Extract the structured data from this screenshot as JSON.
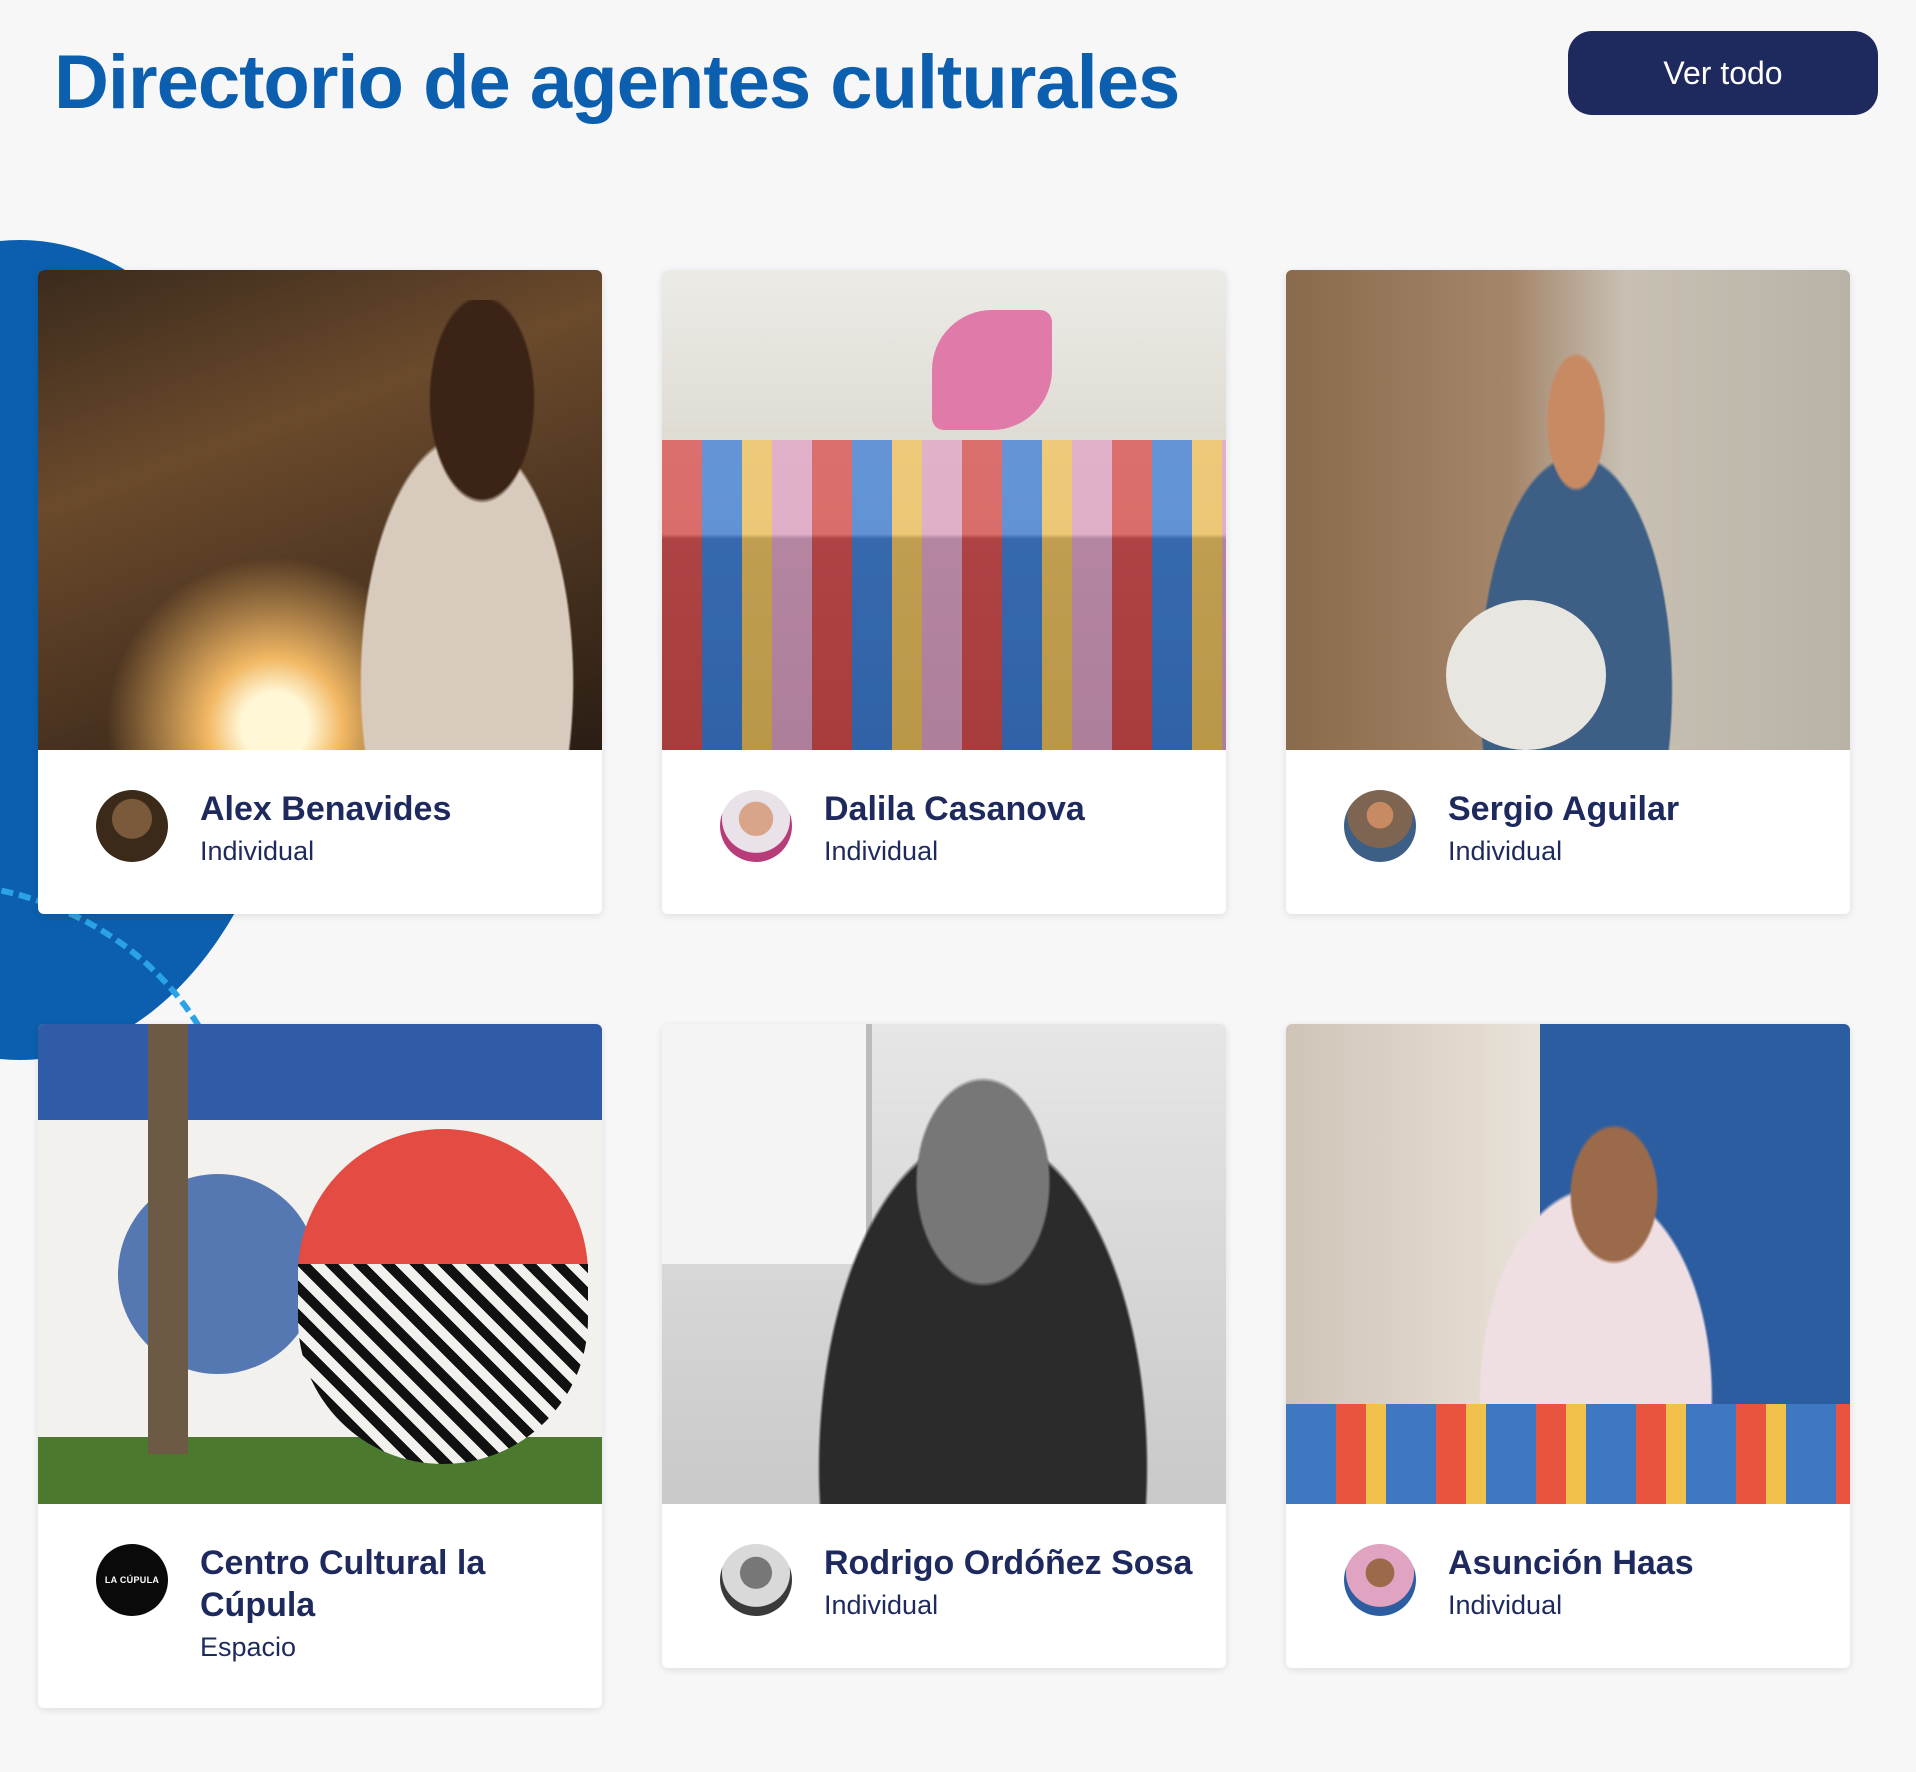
{
  "header": {
    "title": "Directorio de agentes culturales",
    "view_all_label": "Ver todo"
  },
  "colors": {
    "title": "#0b5fae",
    "button_bg": "#1e2a5e",
    "card_text": "#1e2a5e",
    "background": "#f7f7f8"
  },
  "cards": [
    {
      "name": "Alex Benavides",
      "type": "Individual",
      "photo": "stage-audience-photo",
      "avatar": "avatar-photo"
    },
    {
      "name": "Dalila Casanova",
      "type": "Individual",
      "photo": "children-group-photo",
      "avatar": "avatar-photo"
    },
    {
      "name": "Sergio Aguilar",
      "type": "Individual",
      "photo": "guitarist-photo",
      "avatar": "avatar-photo"
    },
    {
      "name": "Centro Cultural la Cúpula",
      "type": "Espacio",
      "photo": "mural-photo",
      "avatar": "logo",
      "avatar_text": "LA CÚPULA"
    },
    {
      "name": "Rodrigo Ordóñez Sosa",
      "type": "Individual",
      "photo": "portrait-bw-photo",
      "avatar": "avatar-photo"
    },
    {
      "name": "Asunción Haas",
      "type": "Individual",
      "photo": "woman-dining-photo",
      "avatar": "avatar-photo"
    }
  ]
}
